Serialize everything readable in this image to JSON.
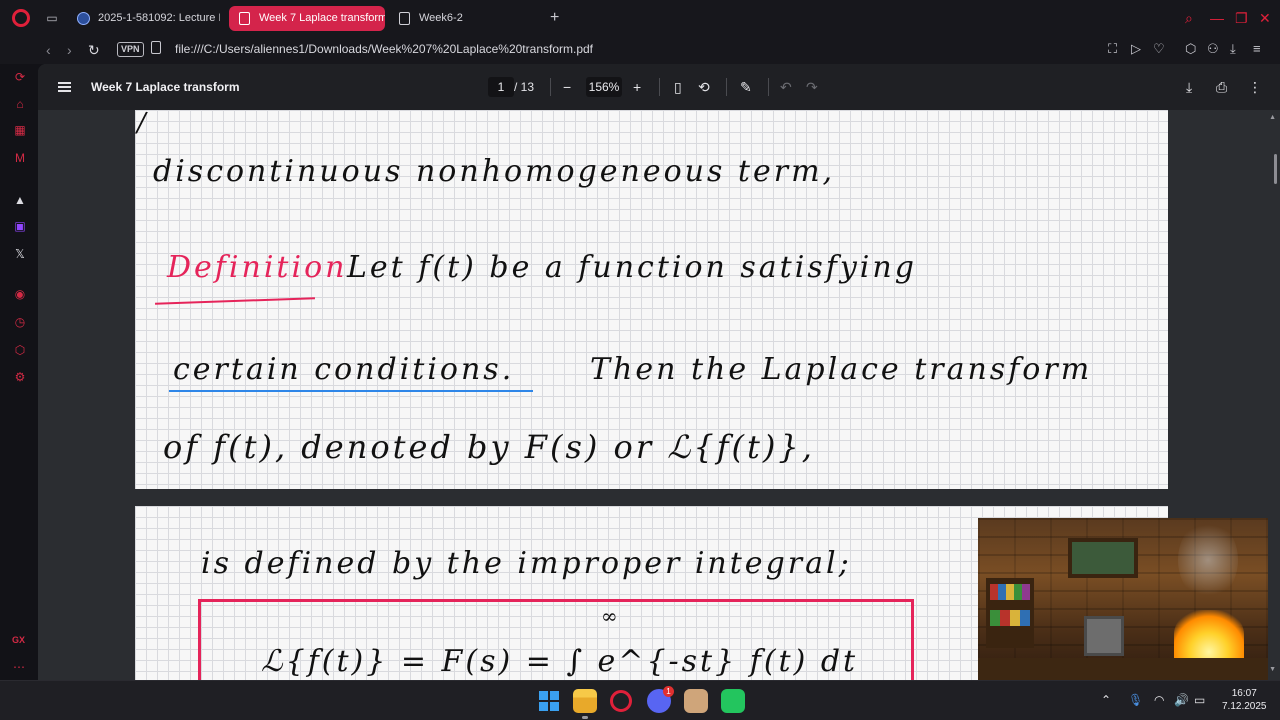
{
  "browser": {
    "tabs": [
      {
        "label": "2025-1-581092: Lecture N",
        "active": false,
        "icon": "globe-icon"
      },
      {
        "label": "Week 7 Laplace transform",
        "active": true,
        "icon": "document-icon"
      },
      {
        "label": "Week6-2",
        "active": false,
        "icon": "document-icon"
      }
    ],
    "new_tab": "+",
    "vpn_badge": "VPN",
    "url": "file:///C:/Users/aliennes1/Downloads/Week%207%20Laplace%20transform.pdf",
    "accent_color": "#d4244b"
  },
  "pdf_toolbar": {
    "title": "Week 7 Laplace transform",
    "current_page": "1",
    "total_pages": "/ 13",
    "zoom": "156%"
  },
  "page1_notes": {
    "line1": "discontinuous nonhomogeneous term,",
    "definition_label": "Definition",
    "line2": "Let f(t) be a function satisfying",
    "line3_underlined": "certain conditions.",
    "line3_rest": "Then the Laplace transform",
    "line4": "of f(t), denoted by F(s) or ℒ{f(t)},"
  },
  "page2_notes": {
    "line1": "is defined by the improper integral;",
    "box_upper_limit": "∞",
    "box_formula": "ℒ{f(t)} = F(s) = ∫ e^{-st} f(t) dt"
  },
  "taskbar": {
    "discord_badge": "1",
    "time": "16:07",
    "date": "7.12.2025"
  }
}
